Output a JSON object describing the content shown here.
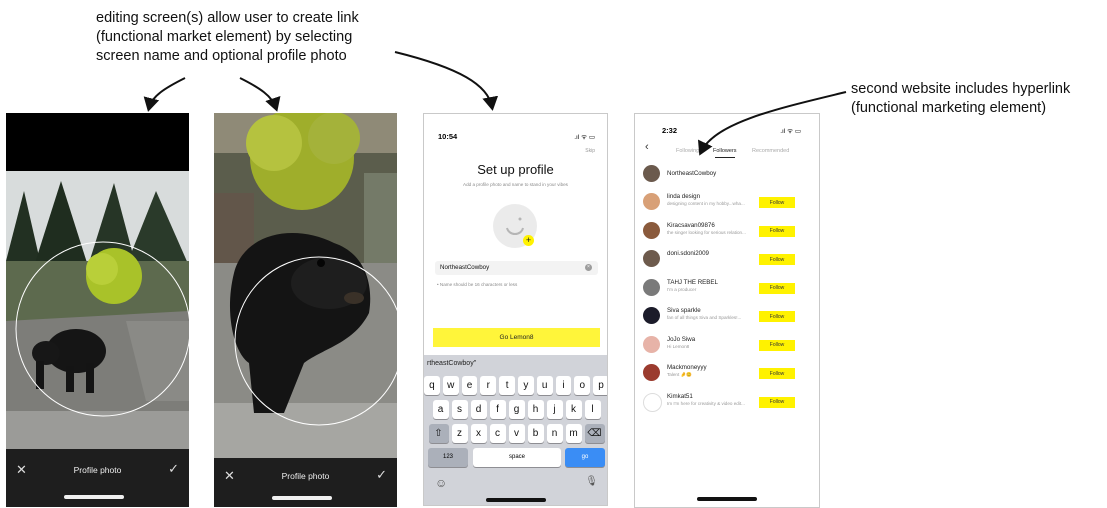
{
  "annotations": {
    "left_lines": [
      "editing screen(s) allow user to create link",
      "(functional market element) by selecting",
      "screen name and optional profile photo"
    ],
    "right_lines": [
      "second website includes hyperlink",
      "(functional marketing element)"
    ]
  },
  "photo_screens": [
    {
      "close": "✕",
      "label": "Profile photo",
      "confirm": "✓"
    },
    {
      "close": "✕",
      "label": "Profile photo",
      "confirm": "✓"
    }
  ],
  "setup": {
    "time": "10:54",
    "status_icons": ".ıl ᯤ ▭",
    "skip": "Skip",
    "title": "Set up profile",
    "subtitle": "Add a profile photo and name to stand in your vibes",
    "name_value": "NortheastCowboy",
    "hint": "• Name should be 16 characters or less",
    "go_button": "Go Lemon8",
    "suggestion": "rtheastCowboy\"",
    "keyboard_rows": [
      [
        "q",
        "w",
        "e",
        "r",
        "t",
        "y",
        "u",
        "i",
        "o",
        "p"
      ],
      [
        "a",
        "s",
        "d",
        "f",
        "g",
        "h",
        "j",
        "k",
        "l"
      ],
      [
        "z",
        "x",
        "c",
        "v",
        "b",
        "n",
        "m"
      ]
    ],
    "key_shift": "⇧",
    "key_delete": "⌫",
    "key_numbers": "123",
    "key_space": "space",
    "key_go": "go",
    "key_emoji": "☺",
    "key_mic": "🎙"
  },
  "followers_screen": {
    "time": "2:32",
    "status_icons": ".ıl ᯤ ▭",
    "back": "‹",
    "tabs": [
      "Following",
      "Followers",
      "Recommended"
    ],
    "active_tab": 1,
    "top_user": "NortheastCowboy",
    "follow_label": "Follow",
    "rows": [
      {
        "name": "linda design",
        "sub": "designing content in my hobby...wha...",
        "color": "#d8a077"
      },
      {
        "name": "Kiracsavan09876",
        "sub": "the singer looking for serious relation...",
        "color": "#8a5a3c"
      },
      {
        "name": "doni.sdoni2009",
        "sub": "",
        "color": "#6d5a4c"
      },
      {
        "name": "TAHJ THE REBEL",
        "sub": "I'm a producer",
        "color": "#7a7a7a"
      },
      {
        "name": "Siva sparkle",
        "sub": "fan of all things Siva and Sparkles!...",
        "color": "#1c1c2a"
      },
      {
        "name": "JoJo Siwa",
        "sub": "Hi Lemon8",
        "color": "#e7b3a8"
      },
      {
        "name": "Mackmoneyyy",
        "sub": "Talent 🤌😊",
        "color": "#9b3b2e"
      },
      {
        "name": "Kimkat51",
        "sub": "Im I'm here for creativity & video edit...",
        "color": "#ffffff"
      }
    ]
  }
}
